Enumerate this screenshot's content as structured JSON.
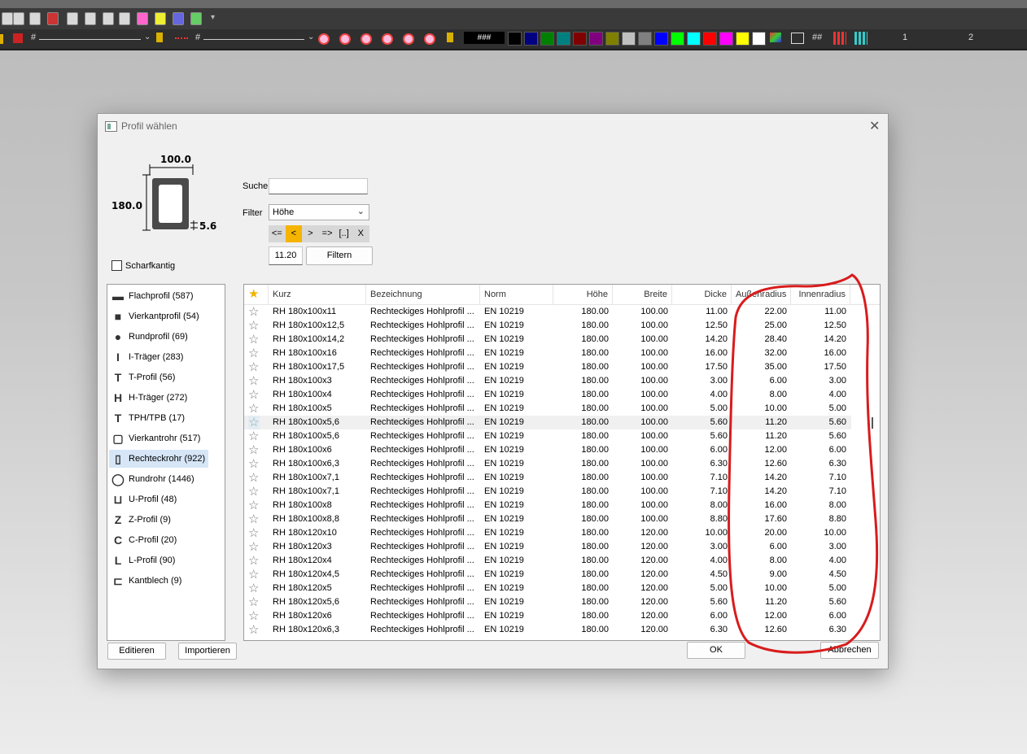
{
  "toolbar": {
    "line_style_label_1": "#",
    "line_style_label_2": "#",
    "text_style": "###",
    "grid_label": "##",
    "page_1": "1",
    "page_2": "2",
    "colors": [
      "#000000",
      "#000080",
      "#008000",
      "#008080",
      "#800000",
      "#800080",
      "#808000",
      "#c0c0c0",
      "#808080",
      "#0000ff",
      "#00ff00",
      "#00ffff",
      "#ff0000",
      "#ff00ff",
      "#ffff00",
      "#ffffff"
    ]
  },
  "dialog": {
    "title": "Profil wählen",
    "preview": {
      "width_label": "100.0",
      "height_label": "180.0",
      "thickness_label": "5.6"
    },
    "sharp_edge_label": "Scharfkantig",
    "search_label": "Suche",
    "search_value": "",
    "filter_label": "Filter",
    "filter_value": "Höhe",
    "operators": [
      "<=",
      "<",
      ">",
      "=>",
      "[..]",
      "X"
    ],
    "active_operator": "<",
    "filter_number": "11.20",
    "filter_button": "Filtern",
    "categories": [
      {
        "label": "Flachprofil (587)",
        "icon": "flat-bar-icon"
      },
      {
        "label": "Vierkantprofil (54)",
        "icon": "square-bar-icon"
      },
      {
        "label": "Rundprofil (69)",
        "icon": "round-bar-icon"
      },
      {
        "label": "I-Träger (283)",
        "icon": "i-beam-icon"
      },
      {
        "label": "T-Profil (56)",
        "icon": "t-profile-icon"
      },
      {
        "label": "H-Träger (272)",
        "icon": "h-beam-icon"
      },
      {
        "label": "TPH/TPB (17)",
        "icon": "tph-icon"
      },
      {
        "label": "Vierkantrohr (517)",
        "icon": "square-tube-icon"
      },
      {
        "label": "Rechteckrohr (922)",
        "icon": "rect-tube-icon"
      },
      {
        "label": "Rundrohr (1446)",
        "icon": "round-tube-icon"
      },
      {
        "label": "U-Profil (48)",
        "icon": "u-profile-icon"
      },
      {
        "label": "Z-Profil (9)",
        "icon": "z-profile-icon"
      },
      {
        "label": "C-Profil (20)",
        "icon": "c-profile-icon"
      },
      {
        "label": "L-Profil (90)",
        "icon": "l-profile-icon"
      },
      {
        "label": "Kantblech (9)",
        "icon": "bent-sheet-icon"
      }
    ],
    "selected_category": 8,
    "columns": [
      "Kurz",
      "Bezeichnung",
      "Norm",
      "Höhe",
      "Breite",
      "Dicke",
      "Außenradius",
      "Innenradius"
    ],
    "selected_row": 8,
    "rows": [
      [
        "RH 180x100x11",
        "Rechteckiges Hohlprofil ...",
        "EN 10219",
        "180.00",
        "100.00",
        "11.00",
        "22.00",
        "11.00"
      ],
      [
        "RH 180x100x12,5",
        "Rechteckiges Hohlprofil ...",
        "EN 10219",
        "180.00",
        "100.00",
        "12.50",
        "25.00",
        "12.50"
      ],
      [
        "RH 180x100x14,2",
        "Rechteckiges Hohlprofil ...",
        "EN 10219",
        "180.00",
        "100.00",
        "14.20",
        "28.40",
        "14.20"
      ],
      [
        "RH 180x100x16",
        "Rechteckiges Hohlprofil ...",
        "EN 10219",
        "180.00",
        "100.00",
        "16.00",
        "32.00",
        "16.00"
      ],
      [
        "RH 180x100x17,5",
        "Rechteckiges Hohlprofil ...",
        "EN 10219",
        "180.00",
        "100.00",
        "17.50",
        "35.00",
        "17.50"
      ],
      [
        "RH 180x100x3",
        "Rechteckiges Hohlprofil ...",
        "EN 10219",
        "180.00",
        "100.00",
        "3.00",
        "6.00",
        "3.00"
      ],
      [
        "RH 180x100x4",
        "Rechteckiges Hohlprofil ...",
        "EN 10219",
        "180.00",
        "100.00",
        "4.00",
        "8.00",
        "4.00"
      ],
      [
        "RH 180x100x5",
        "Rechteckiges Hohlprofil ...",
        "EN 10219",
        "180.00",
        "100.00",
        "5.00",
        "10.00",
        "5.00"
      ],
      [
        "RH 180x100x5,6",
        "Rechteckiges Hohlprofil ...",
        "EN 10219",
        "180.00",
        "100.00",
        "5.60",
        "11.20",
        "5.60"
      ],
      [
        "RH 180x100x5,6",
        "Rechteckiges Hohlprofil ...",
        "EN 10219",
        "180.00",
        "100.00",
        "5.60",
        "11.20",
        "5.60"
      ],
      [
        "RH 180x100x6",
        "Rechteckiges Hohlprofil ...",
        "EN 10219",
        "180.00",
        "100.00",
        "6.00",
        "12.00",
        "6.00"
      ],
      [
        "RH 180x100x6,3",
        "Rechteckiges Hohlprofil ...",
        "EN 10219",
        "180.00",
        "100.00",
        "6.30",
        "12.60",
        "6.30"
      ],
      [
        "RH 180x100x7,1",
        "Rechteckiges Hohlprofil ...",
        "EN 10219",
        "180.00",
        "100.00",
        "7.10",
        "14.20",
        "7.10"
      ],
      [
        "RH 180x100x7,1",
        "Rechteckiges Hohlprofil ...",
        "EN 10219",
        "180.00",
        "100.00",
        "7.10",
        "14.20",
        "7.10"
      ],
      [
        "RH 180x100x8",
        "Rechteckiges Hohlprofil ...",
        "EN 10219",
        "180.00",
        "100.00",
        "8.00",
        "16.00",
        "8.00"
      ],
      [
        "RH 180x100x8,8",
        "Rechteckiges Hohlprofil ...",
        "EN 10219",
        "180.00",
        "100.00",
        "8.80",
        "17.60",
        "8.80"
      ],
      [
        "RH 180x120x10",
        "Rechteckiges Hohlprofil ...",
        "EN 10219",
        "180.00",
        "120.00",
        "10.00",
        "20.00",
        "10.00"
      ],
      [
        "RH 180x120x3",
        "Rechteckiges Hohlprofil ...",
        "EN 10219",
        "180.00",
        "120.00",
        "3.00",
        "6.00",
        "3.00"
      ],
      [
        "RH 180x120x4",
        "Rechteckiges Hohlprofil ...",
        "EN 10219",
        "180.00",
        "120.00",
        "4.00",
        "8.00",
        "4.00"
      ],
      [
        "RH 180x120x4,5",
        "Rechteckiges Hohlprofil ...",
        "EN 10219",
        "180.00",
        "120.00",
        "4.50",
        "9.00",
        "4.50"
      ],
      [
        "RH 180x120x5",
        "Rechteckiges Hohlprofil ...",
        "EN 10219",
        "180.00",
        "120.00",
        "5.00",
        "10.00",
        "5.00"
      ],
      [
        "RH 180x120x5,6",
        "Rechteckiges Hohlprofil ...",
        "EN 10219",
        "180.00",
        "120.00",
        "5.60",
        "11.20",
        "5.60"
      ],
      [
        "RH 180x120x6",
        "Rechteckiges Hohlprofil ...",
        "EN 10219",
        "180.00",
        "120.00",
        "6.00",
        "12.00",
        "6.00"
      ],
      [
        "RH 180x120x6,3",
        "Rechteckiges Hohlprofil ...",
        "EN 10219",
        "180.00",
        "120.00",
        "6.30",
        "12.60",
        "6.30"
      ]
    ],
    "buttons": {
      "edit": "Editieren",
      "import": "Importieren",
      "ok": "OK",
      "cancel": "Abbrechen"
    }
  }
}
